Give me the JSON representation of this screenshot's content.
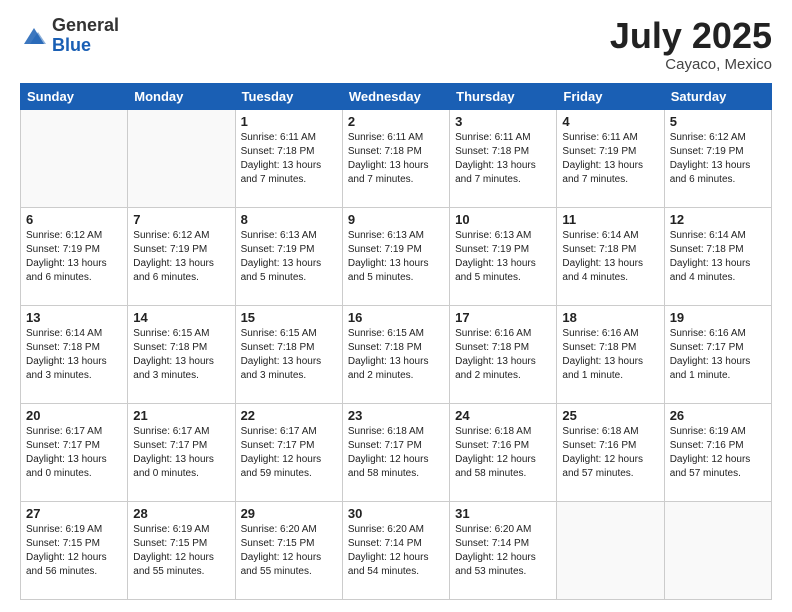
{
  "logo": {
    "general": "General",
    "blue": "Blue"
  },
  "title": "July 2025",
  "location": "Cayaco, Mexico",
  "weekdays": [
    "Sunday",
    "Monday",
    "Tuesday",
    "Wednesday",
    "Thursday",
    "Friday",
    "Saturday"
  ],
  "weeks": [
    [
      {
        "day": "",
        "info": ""
      },
      {
        "day": "",
        "info": ""
      },
      {
        "day": "1",
        "info": "Sunrise: 6:11 AM\nSunset: 7:18 PM\nDaylight: 13 hours and 7 minutes."
      },
      {
        "day": "2",
        "info": "Sunrise: 6:11 AM\nSunset: 7:18 PM\nDaylight: 13 hours and 7 minutes."
      },
      {
        "day": "3",
        "info": "Sunrise: 6:11 AM\nSunset: 7:18 PM\nDaylight: 13 hours and 7 minutes."
      },
      {
        "day": "4",
        "info": "Sunrise: 6:11 AM\nSunset: 7:19 PM\nDaylight: 13 hours and 7 minutes."
      },
      {
        "day": "5",
        "info": "Sunrise: 6:12 AM\nSunset: 7:19 PM\nDaylight: 13 hours and 6 minutes."
      }
    ],
    [
      {
        "day": "6",
        "info": "Sunrise: 6:12 AM\nSunset: 7:19 PM\nDaylight: 13 hours and 6 minutes."
      },
      {
        "day": "7",
        "info": "Sunrise: 6:12 AM\nSunset: 7:19 PM\nDaylight: 13 hours and 6 minutes."
      },
      {
        "day": "8",
        "info": "Sunrise: 6:13 AM\nSunset: 7:19 PM\nDaylight: 13 hours and 5 minutes."
      },
      {
        "day": "9",
        "info": "Sunrise: 6:13 AM\nSunset: 7:19 PM\nDaylight: 13 hours and 5 minutes."
      },
      {
        "day": "10",
        "info": "Sunrise: 6:13 AM\nSunset: 7:19 PM\nDaylight: 13 hours and 5 minutes."
      },
      {
        "day": "11",
        "info": "Sunrise: 6:14 AM\nSunset: 7:18 PM\nDaylight: 13 hours and 4 minutes."
      },
      {
        "day": "12",
        "info": "Sunrise: 6:14 AM\nSunset: 7:18 PM\nDaylight: 13 hours and 4 minutes."
      }
    ],
    [
      {
        "day": "13",
        "info": "Sunrise: 6:14 AM\nSunset: 7:18 PM\nDaylight: 13 hours and 3 minutes."
      },
      {
        "day": "14",
        "info": "Sunrise: 6:15 AM\nSunset: 7:18 PM\nDaylight: 13 hours and 3 minutes."
      },
      {
        "day": "15",
        "info": "Sunrise: 6:15 AM\nSunset: 7:18 PM\nDaylight: 13 hours and 3 minutes."
      },
      {
        "day": "16",
        "info": "Sunrise: 6:15 AM\nSunset: 7:18 PM\nDaylight: 13 hours and 2 minutes."
      },
      {
        "day": "17",
        "info": "Sunrise: 6:16 AM\nSunset: 7:18 PM\nDaylight: 13 hours and 2 minutes."
      },
      {
        "day": "18",
        "info": "Sunrise: 6:16 AM\nSunset: 7:18 PM\nDaylight: 13 hours and 1 minute."
      },
      {
        "day": "19",
        "info": "Sunrise: 6:16 AM\nSunset: 7:17 PM\nDaylight: 13 hours and 1 minute."
      }
    ],
    [
      {
        "day": "20",
        "info": "Sunrise: 6:17 AM\nSunset: 7:17 PM\nDaylight: 13 hours and 0 minutes."
      },
      {
        "day": "21",
        "info": "Sunrise: 6:17 AM\nSunset: 7:17 PM\nDaylight: 13 hours and 0 minutes."
      },
      {
        "day": "22",
        "info": "Sunrise: 6:17 AM\nSunset: 7:17 PM\nDaylight: 12 hours and 59 minutes."
      },
      {
        "day": "23",
        "info": "Sunrise: 6:18 AM\nSunset: 7:17 PM\nDaylight: 12 hours and 58 minutes."
      },
      {
        "day": "24",
        "info": "Sunrise: 6:18 AM\nSunset: 7:16 PM\nDaylight: 12 hours and 58 minutes."
      },
      {
        "day": "25",
        "info": "Sunrise: 6:18 AM\nSunset: 7:16 PM\nDaylight: 12 hours and 57 minutes."
      },
      {
        "day": "26",
        "info": "Sunrise: 6:19 AM\nSunset: 7:16 PM\nDaylight: 12 hours and 57 minutes."
      }
    ],
    [
      {
        "day": "27",
        "info": "Sunrise: 6:19 AM\nSunset: 7:15 PM\nDaylight: 12 hours and 56 minutes."
      },
      {
        "day": "28",
        "info": "Sunrise: 6:19 AM\nSunset: 7:15 PM\nDaylight: 12 hours and 55 minutes."
      },
      {
        "day": "29",
        "info": "Sunrise: 6:20 AM\nSunset: 7:15 PM\nDaylight: 12 hours and 55 minutes."
      },
      {
        "day": "30",
        "info": "Sunrise: 6:20 AM\nSunset: 7:14 PM\nDaylight: 12 hours and 54 minutes."
      },
      {
        "day": "31",
        "info": "Sunrise: 6:20 AM\nSunset: 7:14 PM\nDaylight: 12 hours and 53 minutes."
      },
      {
        "day": "",
        "info": ""
      },
      {
        "day": "",
        "info": ""
      }
    ]
  ]
}
